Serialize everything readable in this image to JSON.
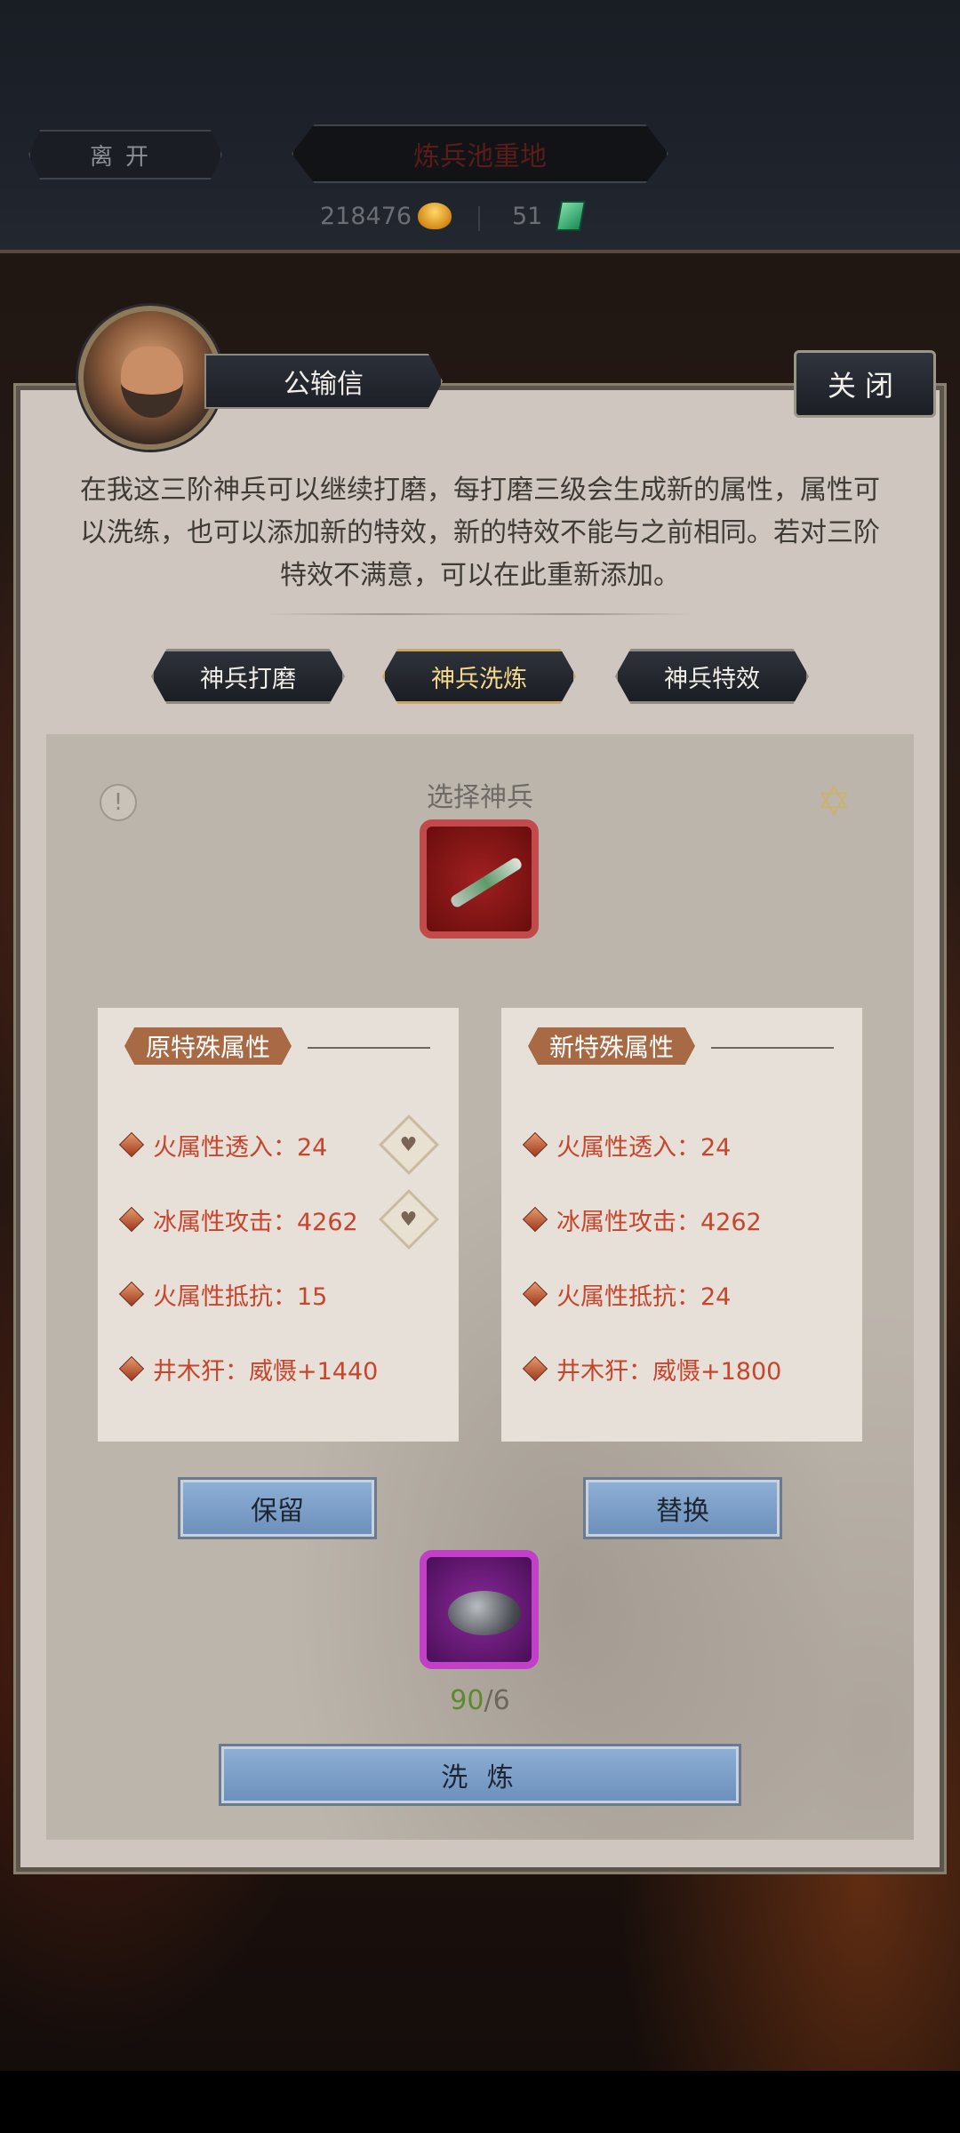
{
  "header": {
    "leave_label": "离开",
    "title": "炼兵池重地",
    "gold": "218476",
    "jade": "51"
  },
  "dialog": {
    "npc_name": "公输信",
    "close_label": "关闭",
    "intro": "在我这三阶神兵可以继续打磨，每打磨三级会生成新的属性，属性可以洗练，也可以添加新的特效，新的特效不能与之前相同。若对三阶特效不满意，可以在此重新添加。",
    "tabs": [
      {
        "label": "神兵打磨"
      },
      {
        "label": "神兵洗炼"
      },
      {
        "label": "神兵特效"
      }
    ],
    "active_tab": "神兵洗炼",
    "select_label": "选择神兵",
    "old_attr": {
      "header": "原特殊属性",
      "rows": [
        "火属性透入：24",
        "冰属性攻击：4262",
        "火属性抵抗：15",
        "井木犴：威慑+1440"
      ]
    },
    "new_attr": {
      "header": "新特殊属性",
      "rows": [
        "火属性透入：24",
        "冰属性攻击：4262",
        "火属性抵抗：24",
        "井木犴：威慑+1800"
      ]
    },
    "keep_label": "保留",
    "replace_label": "替换",
    "material_have": "90",
    "material_need": "/6",
    "refine_label": "洗 炼",
    "colors": {
      "accent": "#a86a44",
      "attr_text": "#c8452c",
      "button": "#7e9fca"
    }
  }
}
